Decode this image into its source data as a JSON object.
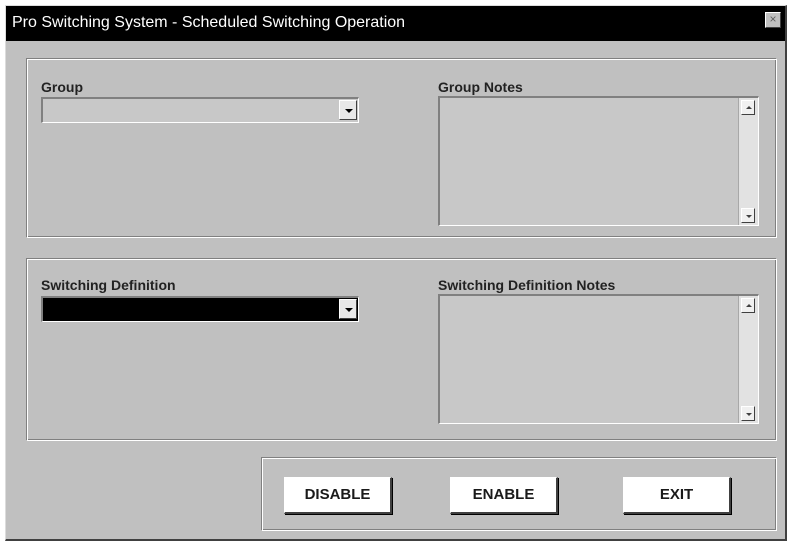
{
  "window": {
    "title": "Pro Switching System - Scheduled Switching Operation",
    "close_glyph": "×"
  },
  "group_panel": {
    "group_label": "Group",
    "group_value": "",
    "notes_label": "Group Notes",
    "notes_value": ""
  },
  "definition_panel": {
    "definition_label": "Switching Definition",
    "definition_value": "",
    "notes_label": "Switching Definition Notes",
    "notes_value": ""
  },
  "actions": {
    "disable_label": "DISABLE",
    "enable_label": "ENABLE",
    "exit_label": "EXIT"
  },
  "colors": {
    "title_bar": "#000000",
    "window_face": "#c0c0c0",
    "selected_combo": "#000000"
  }
}
